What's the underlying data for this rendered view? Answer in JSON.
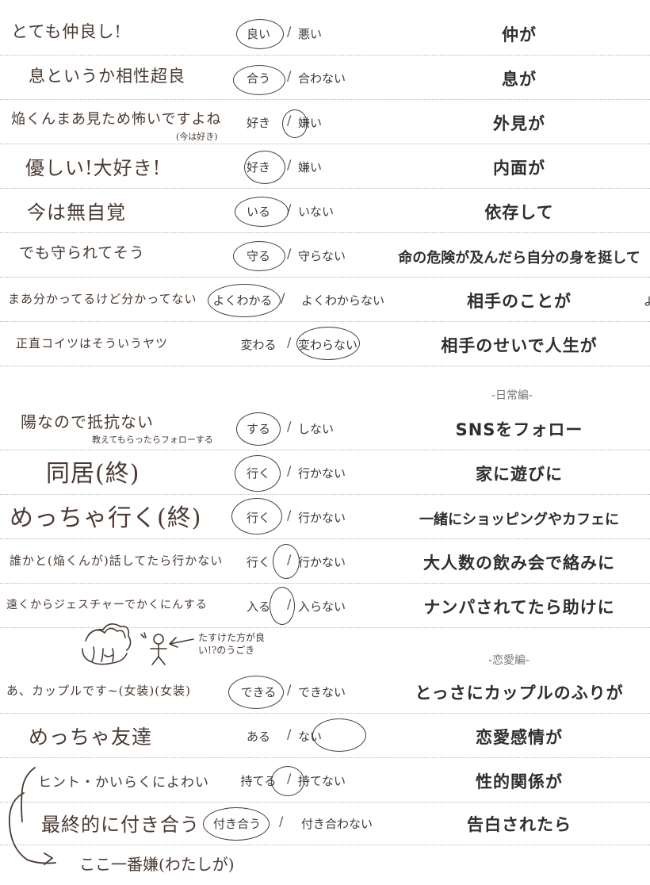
{
  "rows1": [
    {
      "note": "とても仲良し!",
      "a": "良い",
      "b": "悪い",
      "prompt": "仲が",
      "circled": "a"
    },
    {
      "note": "息というか相性超良",
      "a": "合う",
      "b": "合わない",
      "prompt": "息が",
      "circled": "a"
    },
    {
      "note": "焔くんまあ見ため怖いですよね",
      "note_sub": "(今は好き)",
      "a": "好き",
      "b": "嫌い",
      "prompt": "外見が",
      "circled": "slash"
    },
    {
      "note": "優しい!大好き!",
      "a": "好き",
      "b": "嫌い",
      "prompt": "内面が",
      "circled": "a"
    },
    {
      "note": "今は無自覚",
      "a": "いる",
      "b": "いない",
      "prompt": "依存して",
      "circled": "a"
    },
    {
      "note": "でも守られてそう",
      "a": "守る",
      "b": "守らない",
      "prompt": "命の危険が及んだら自分の身を挺して",
      "circled": "a"
    },
    {
      "note": "まあ分かってるけど分かってない",
      "a": "よくわかる",
      "b": "よくわからない",
      "prompt": "相手のことが",
      "circled": "a",
      "edge": "よ"
    },
    {
      "note": "正直コイツはそういうヤツ",
      "a": "変わる",
      "b": "変わらない",
      "prompt": "相手のせいで人生が",
      "circled": "b"
    }
  ],
  "section_daily": "-日常編-",
  "rows2": [
    {
      "note": "陽なので抵抗ない",
      "note_sub": "教えてもらったらフォローする",
      "a": "する",
      "b": "しない",
      "prompt": "SNSをフォロー",
      "circled": "a"
    },
    {
      "note": "同居(終)",
      "a": "行く",
      "b": "行かない",
      "prompt": "家に遊びに",
      "circled": "a"
    },
    {
      "note": "めっちゃ行く(終)",
      "a": "行く",
      "b": "行かない",
      "prompt": "一緒にショッピングやカフェに",
      "circled": "a"
    },
    {
      "note": "誰かと(焔くんが)話してたら行かない",
      "a": "行く",
      "b": "行かない",
      "prompt": "大人数の飲み会で絡みに",
      "circled": "slash"
    },
    {
      "note": "遠くからジェスチャーでかくにんする",
      "a": "入る",
      "b": "入らない",
      "prompt": "ナンパされてたら助けに",
      "circled": "slash"
    }
  ],
  "doodle_note": "たすけた方が良い!?のうごき",
  "section_love": "-恋愛編-",
  "rows3": [
    {
      "note": "あ、カップルです~(女装)(女装)",
      "a": "できる",
      "b": "できない",
      "prompt": "とっさにカップルのふりが",
      "circled": "a"
    },
    {
      "note": "めっちゃ友達",
      "a": "ある",
      "b": "ない",
      "prompt": "恋愛感情が",
      "circled": "b"
    },
    {
      "note": "ヒント・かいらくによわい",
      "a": "持てる",
      "b": "持てない",
      "prompt": "性的関係が",
      "circled": "slash"
    },
    {
      "note": "最終的に付き合う",
      "a": "付き合う",
      "b": "付き合わない",
      "prompt": "告白されたら",
      "circled": "a"
    }
  ],
  "bottom_note": "ここ一番嫌(わたしが)",
  "slash": "/"
}
